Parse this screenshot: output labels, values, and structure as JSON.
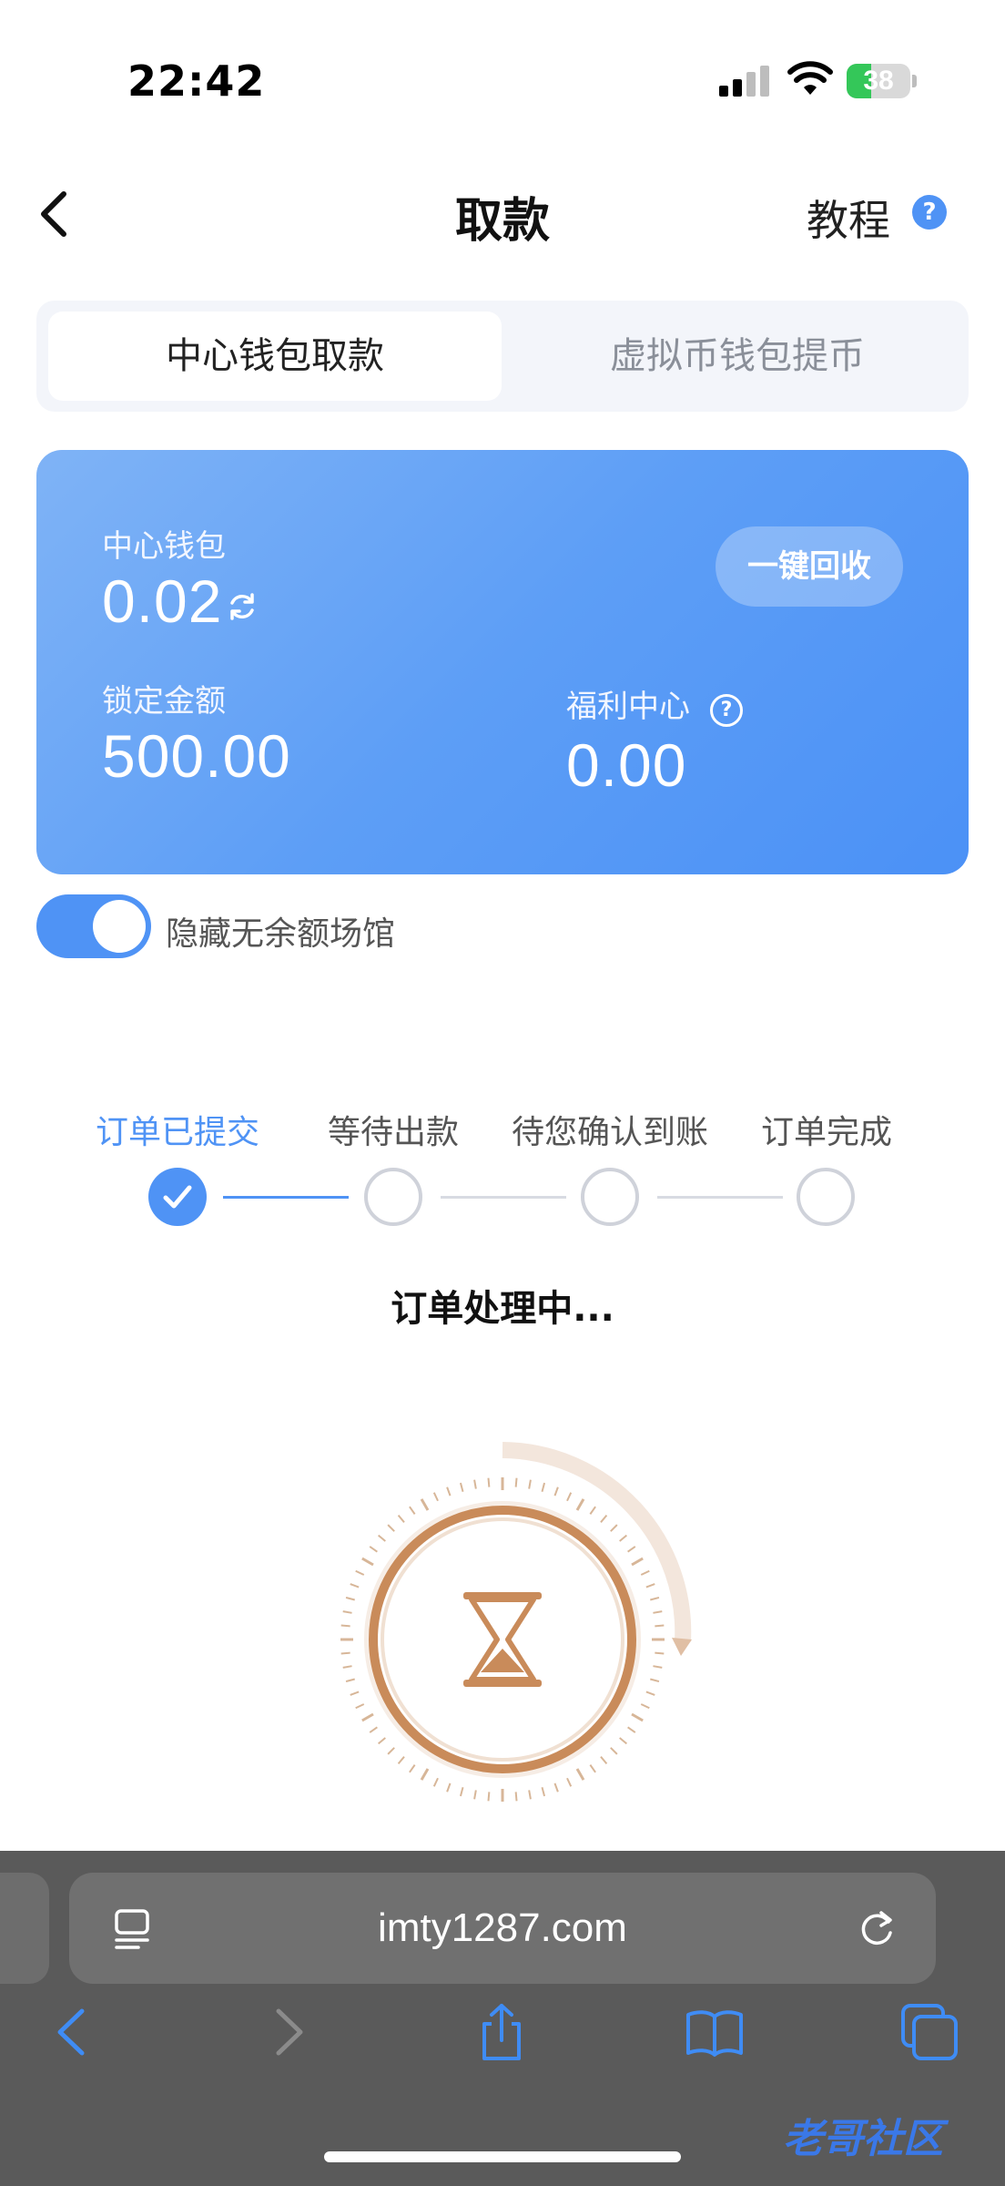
{
  "status_bar": {
    "time": "22:42",
    "battery": "38",
    "battery_level": 0.38
  },
  "header": {
    "title": "取款",
    "tutorial_label": "教程",
    "help_badge": "?"
  },
  "tabs": [
    {
      "label": "中心钱包取款",
      "active": true
    },
    {
      "label": "虚拟币钱包提币",
      "active": false
    }
  ],
  "wallet_card": {
    "center_wallet_label": "中心钱包",
    "center_wallet_amount": "0.02",
    "recycle_label": "一键回收",
    "locked_label": "锁定金额",
    "locked_amount": "500.00",
    "welfare_label": "福利中心",
    "welfare_amount": "0.00"
  },
  "toggle": {
    "label": "隐藏无余额场馆",
    "on": true
  },
  "steps": [
    {
      "label": "订单已提交",
      "done": true
    },
    {
      "label": "等待出款",
      "done": false
    },
    {
      "label": "待您确认到账",
      "done": false
    },
    {
      "label": "订单完成",
      "done": false
    }
  ],
  "order_status": "订单处理中...",
  "browser": {
    "url": "imty1287.com"
  },
  "watermark": "老哥社区",
  "colors": {
    "accent": "#4f93f5",
    "card_start": "#7fb3f6",
    "card_end": "#4b91f6",
    "hourglass": "#c98b5a"
  }
}
